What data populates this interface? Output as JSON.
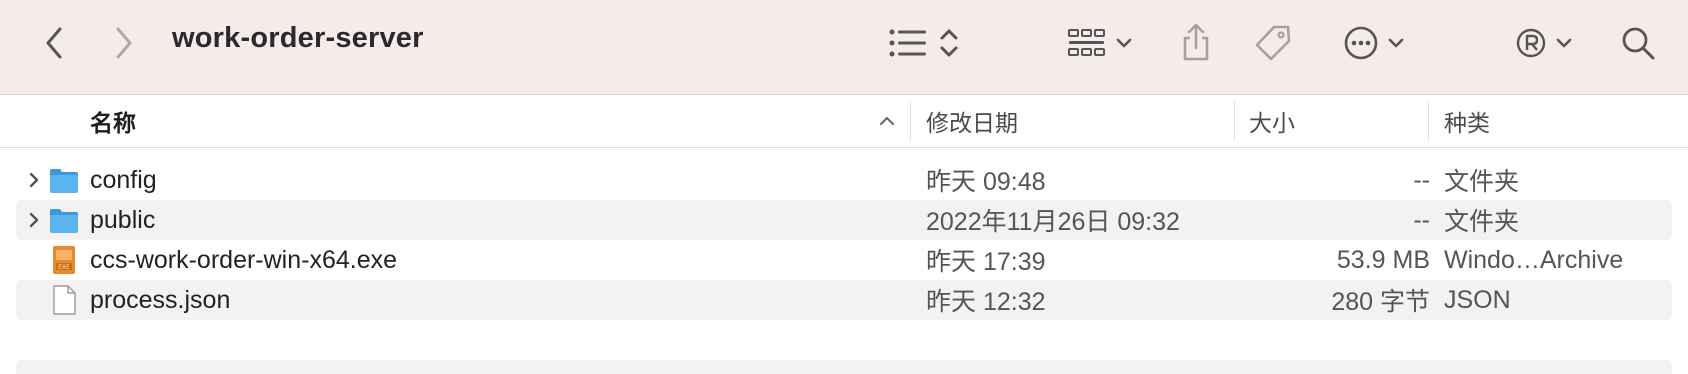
{
  "window": {
    "title": "work-order-server"
  },
  "columns": {
    "name": "名称",
    "modified": "修改日期",
    "size": "大小",
    "kind": "种类"
  },
  "files": [
    {
      "name": "config",
      "modified": "昨天 09:48",
      "size": "--",
      "kind": "文件夹",
      "icon": "folder-icon"
    },
    {
      "name": "public",
      "modified": "2022年11月26日 09:32",
      "size": "--",
      "kind": "文件夹",
      "icon": "folder-icon"
    },
    {
      "name": "ccs-work-order-win-x64.exe",
      "modified": "昨天 17:39",
      "size": "53.9 MB",
      "kind": "Windo…Archive",
      "icon": "exe-file-icon"
    },
    {
      "name": "process.json",
      "modified": "昨天 12:32",
      "size": "280 字节",
      "kind": "JSON",
      "icon": "document-icon"
    }
  ],
  "colors": {
    "toolbar_bg": "#f5ebea",
    "folder_blue": "#4aa8e8",
    "exe_orange": "#e8892a",
    "alt_row": "#f2f2f2"
  }
}
